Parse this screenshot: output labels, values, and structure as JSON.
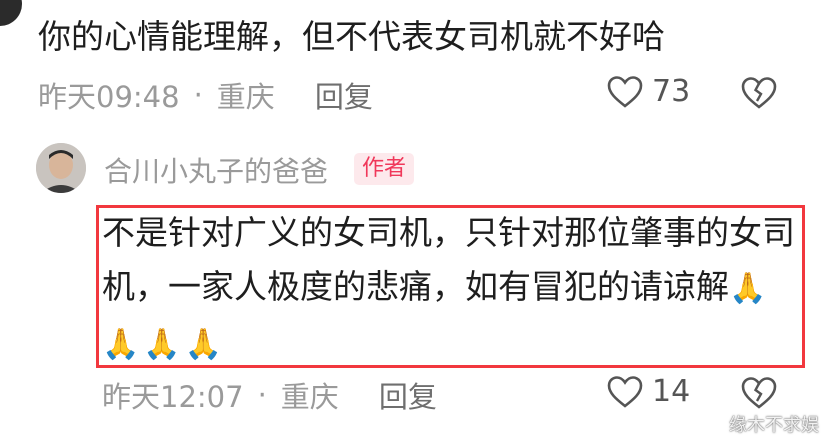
{
  "comment1": {
    "text": "你的心情能理解，但不代表女司机就不好哈",
    "time": "昨天09:48",
    "sep": "·",
    "location": "重庆",
    "reply_label": "回复",
    "likes": "73"
  },
  "comment2": {
    "username": "合川小丸子的爸爸",
    "badge": "作者",
    "text": "不是针对广义的女司机，只针对那位肇事的女司机，一家人极度的悲痛，如有冒犯的请谅解",
    "emoji": "🙏🙏🙏🙏",
    "time": "昨天12:07",
    "sep": "·",
    "location": "重庆",
    "reply_label": "回复",
    "likes": "14"
  },
  "watermark": "缘木不求娱",
  "colors": {
    "highlight": "#f2383e",
    "badge_text": "#f0385a",
    "badge_bg": "#fde9ec"
  }
}
